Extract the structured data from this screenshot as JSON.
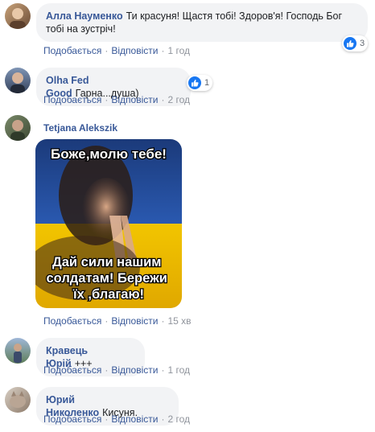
{
  "comments": [
    {
      "author": "Алла Науменко",
      "text": "Ти красуня! Щастя тобі! Здоров'я! Господь Бог тобі на зустріч!",
      "like_label": "Подобається",
      "reply_label": "Відповісти",
      "time": "1 год",
      "reaction_count": "3"
    },
    {
      "author": "Olha Fed Good",
      "text": "Гарна...душа)",
      "like_label": "Подобається",
      "reply_label": "Відповісти",
      "time": "2 год",
      "reaction_count": "1"
    },
    {
      "author": "Tetjana Alekszik",
      "meme_top_text": "Боже,молю тебе!",
      "meme_bottom_text": "Дай сили нашим солдатам! Бережи їх ,благаю!",
      "like_label": "Подобається",
      "reply_label": "Відповісти",
      "time": "15 хв"
    },
    {
      "author": "Кравець Юрій",
      "text": "+++",
      "like_label": "Подобається",
      "reply_label": "Відповісти",
      "time": "1 год"
    },
    {
      "author": "Юрий Николенко",
      "text": "Кисуня.",
      "like_label": "Подобається",
      "reply_label": "Відповісти",
      "time": "2 год"
    }
  ],
  "colors": {
    "link": "#385898",
    "bubble_bg": "#f2f3f5",
    "like_blue": "#1877f2",
    "meta_gray": "#90949c"
  }
}
